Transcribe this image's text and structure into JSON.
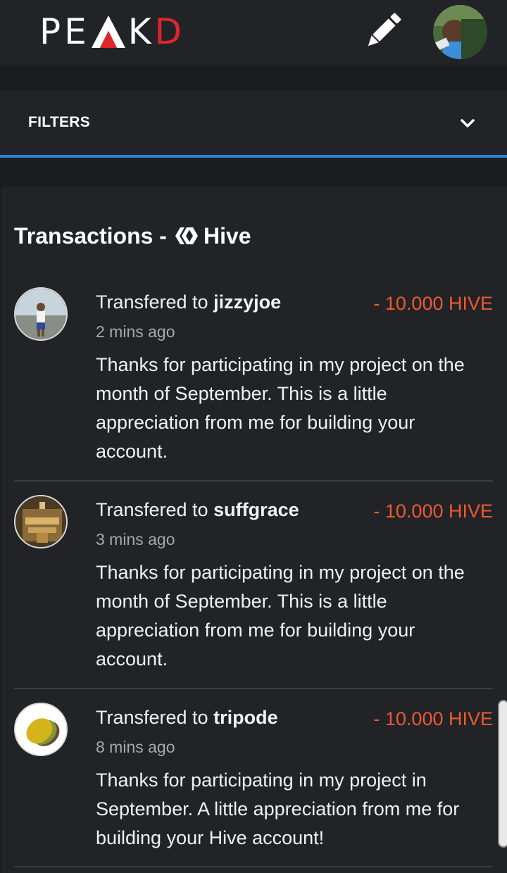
{
  "header": {
    "logo_text_left": "PE",
    "logo_text_mid": "K",
    "logo_text_right": "D"
  },
  "filters": {
    "label": "FILTERS"
  },
  "section": {
    "title_prefix": "Transactions -",
    "title_suffix": "Hive"
  },
  "transactions": [
    {
      "prefix": "Transfered to",
      "user": "jizzyjoe",
      "amount": "- 10.000 HIVE",
      "time": "2 mins ago",
      "memo": "Thanks for participating in my project on the month of September. This is a little appreciation from me for building your account."
    },
    {
      "prefix": "Transfered to",
      "user": "suffgrace",
      "amount": "- 10.000 HIVE",
      "time": "3 mins ago",
      "memo": "Thanks for participating in my project on the month of September. This is a little appreciation from me for building your account."
    },
    {
      "prefix": "Transfered to",
      "user": "tripode",
      "amount": "- 10.000 HIVE",
      "time": "8 mins ago",
      "memo": "Thanks for participating in my project in September. A little appreciation from me for building your Hive account!"
    }
  ],
  "colors": {
    "accent_blue": "#2b82e0",
    "amount_red": "#ee5a30",
    "logo_red": "#e0262c"
  },
  "icons": [
    "pencil-icon",
    "chevron-down-icon",
    "hive-logo-icon"
  ]
}
